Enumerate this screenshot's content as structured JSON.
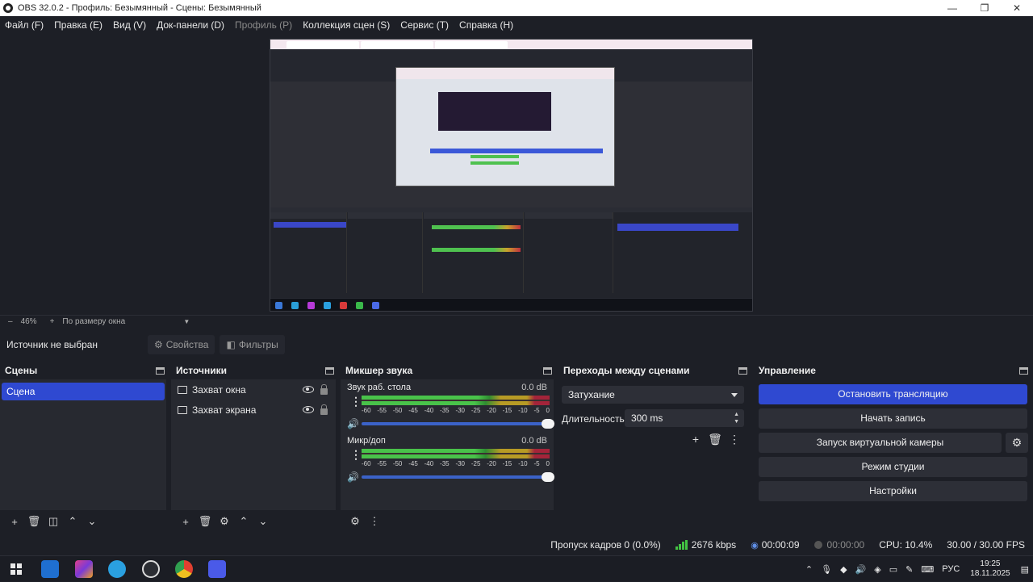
{
  "window": {
    "title": "OBS 32.0.2 - Профиль: Безымянный - Сцены: Безымянный",
    "minimize": "—",
    "maximize": "❐",
    "close": "✕"
  },
  "menu": [
    {
      "label": "Файл (F)",
      "disabled": false
    },
    {
      "label": "Правка (E)",
      "disabled": false
    },
    {
      "label": "Вид (V)",
      "disabled": false
    },
    {
      "label": "Док-панели (D)",
      "disabled": false
    },
    {
      "label": "Профиль (P)",
      "disabled": true
    },
    {
      "label": "Коллекция сцен (S)",
      "disabled": false
    },
    {
      "label": "Сервис (T)",
      "disabled": false
    },
    {
      "label": "Справка (H)",
      "disabled": false
    }
  ],
  "zoombar": {
    "dash": "–",
    "zoom": "46%",
    "plus": "+",
    "fit": "По размеру окна"
  },
  "source_toolbar": {
    "no_source": "Источник не выбран",
    "properties": "Свойства",
    "filters": "Фильтры"
  },
  "scenes": {
    "title": "Сцены",
    "items": [
      "Сцена"
    ]
  },
  "sources": {
    "title": "Источники",
    "items": [
      {
        "label": "Захват окна",
        "icon": "window-capture-icon"
      },
      {
        "label": "Захват экрана",
        "icon": "display-capture-icon"
      }
    ]
  },
  "mixer": {
    "title": "Микшер звука",
    "scale": [
      "-60",
      "-55",
      "-50",
      "-45",
      "-40",
      "-35",
      "-30",
      "-25",
      "-20",
      "-15",
      "-10",
      "-5",
      "0"
    ],
    "channels": [
      {
        "name": "Звук раб. стола",
        "db": "0.0 dB",
        "volume": 1.0
      },
      {
        "name": "Микр/доп",
        "db": "0.0 dB",
        "volume": 1.0
      }
    ]
  },
  "transitions": {
    "title": "Переходы между сценами",
    "selected": "Затухание",
    "duration_label": "Длительность",
    "duration_value": "300 ms"
  },
  "controls": {
    "title": "Управление",
    "stop_stream": "Остановить трансляцию",
    "start_record": "Начать запись",
    "virtual_cam": "Запуск виртуальной камеры",
    "studio_mode": "Режим студии",
    "settings": "Настройки"
  },
  "status": {
    "dropped_frames": "Пропуск кадров 0 (0.0%)",
    "bitrate": "2676 kbps",
    "stream_time": "00:00:09",
    "record_time": "00:00:00",
    "cpu": "CPU: 10.4%",
    "fps": "30.00 / 30.00 FPS"
  },
  "taskbar": {
    "language": "РУС",
    "time": "19:25",
    "date": "18.11.2025"
  },
  "colors": {
    "accent": "#2f49d1",
    "background": "#1d1f26",
    "panel": "#272930"
  }
}
